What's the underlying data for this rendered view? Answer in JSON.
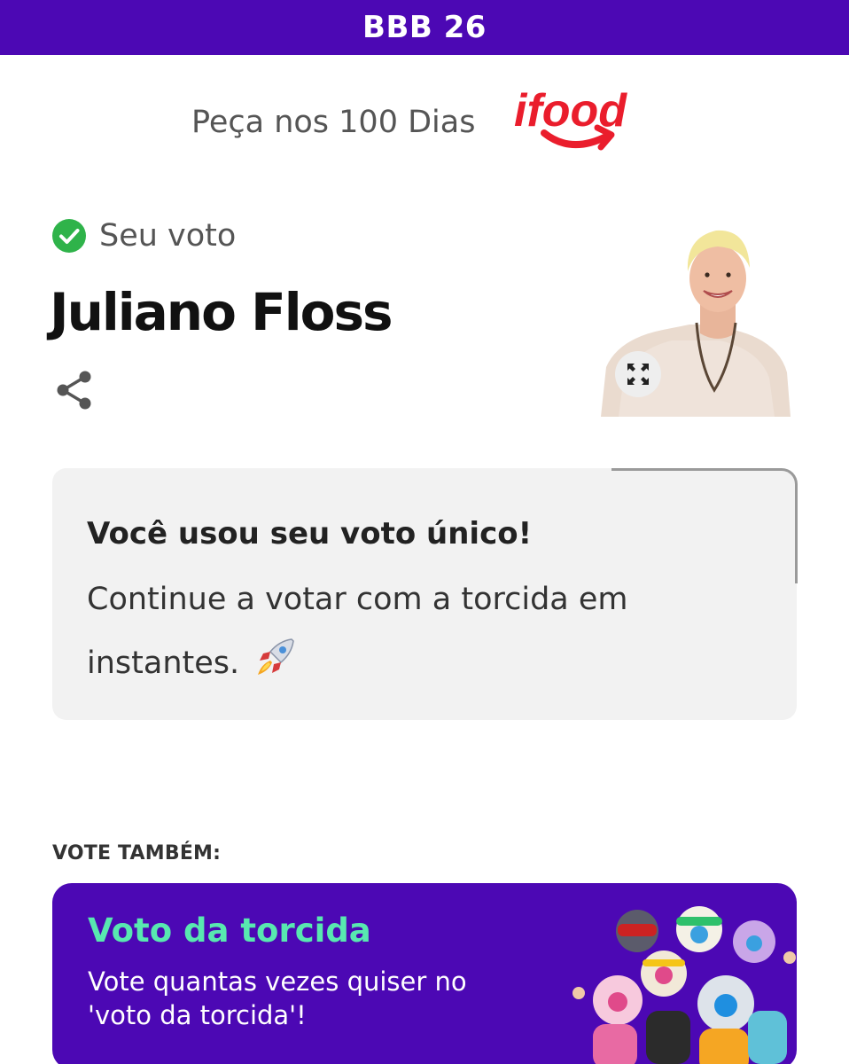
{
  "header": {
    "title": "BBB 26"
  },
  "sponsor": {
    "text": "Peça nos 100 Dias",
    "logo": "ifood"
  },
  "vote": {
    "status_label": "Seu voto",
    "candidate_name": "Juliano Floss"
  },
  "notice": {
    "title": "Você usou seu voto único!",
    "body": "Continue a votar com a torcida em instantes."
  },
  "also": {
    "label": "VOTE TAMBÉM:",
    "card_title": "Voto da torcida",
    "card_description": "Vote quantas vezes quiser no 'voto da torcida'!"
  },
  "colors": {
    "brand_purple": "#4c08b4",
    "accent_green": "#58e8b0",
    "check_green": "#2fb34a",
    "ifood_red": "#ea1d2c"
  }
}
